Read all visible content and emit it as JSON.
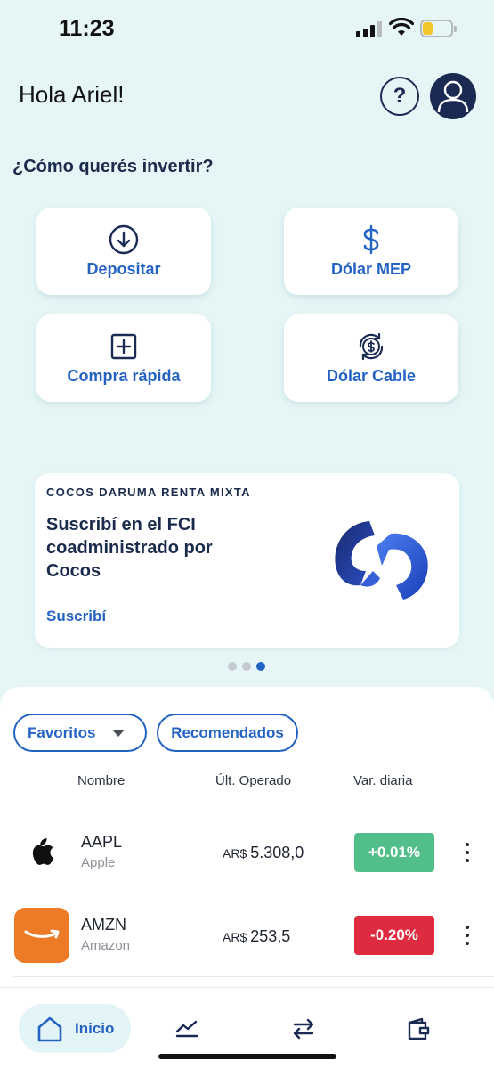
{
  "status_bar": {
    "time": "11:23"
  },
  "header": {
    "greeting": "Hola Ariel!",
    "help_label": "?"
  },
  "invest": {
    "question": "¿Cómo querés invertir?",
    "actions": [
      {
        "label": "Depositar",
        "icon": "download-circle-icon"
      },
      {
        "label": "Dólar MEP",
        "icon": "dollar-icon"
      },
      {
        "label": "Compra rápida",
        "icon": "plus-square-icon"
      },
      {
        "label": "Dólar Cable",
        "icon": "dollar-exchange-icon"
      }
    ]
  },
  "promo": {
    "overline": "COCOS DARUMA RENTA MIXTA",
    "title": "Suscribí en el FCI coadministrado por Cocos",
    "link": "Suscribí",
    "carousel": {
      "count": 3,
      "active": 3
    }
  },
  "market": {
    "filters": {
      "dropdown_label": "Favoritos",
      "chip_label": "Recomendados"
    },
    "columns": {
      "name": "Nombre",
      "last": "Últ. Operado",
      "var": "Var. diaria"
    },
    "rows": [
      {
        "ticker": "AAPL",
        "company": "Apple",
        "currency": "AR$",
        "price": "5.308,0",
        "variation": "+0.01%",
        "positive": true,
        "logo": "apple-logo-icon"
      },
      {
        "ticker": "AMZN",
        "company": "Amazon",
        "currency": "AR$",
        "price": "253,5",
        "variation": "-0.20%",
        "positive": false,
        "logo": "amazon-logo-icon"
      }
    ],
    "colors": {
      "positive": "#52bf8b",
      "negative": "#de2b3f",
      "accent": "#2463c4",
      "navy": "#1b2a52",
      "amazon": "#ec7a26"
    }
  },
  "nav": {
    "items": [
      {
        "label": "Inicio",
        "icon": "home-icon",
        "active": true
      },
      {
        "label": "",
        "icon": "chart-line-icon"
      },
      {
        "label": "",
        "icon": "transfer-arrows-icon"
      },
      {
        "label": "",
        "icon": "wallet-icon"
      }
    ]
  }
}
